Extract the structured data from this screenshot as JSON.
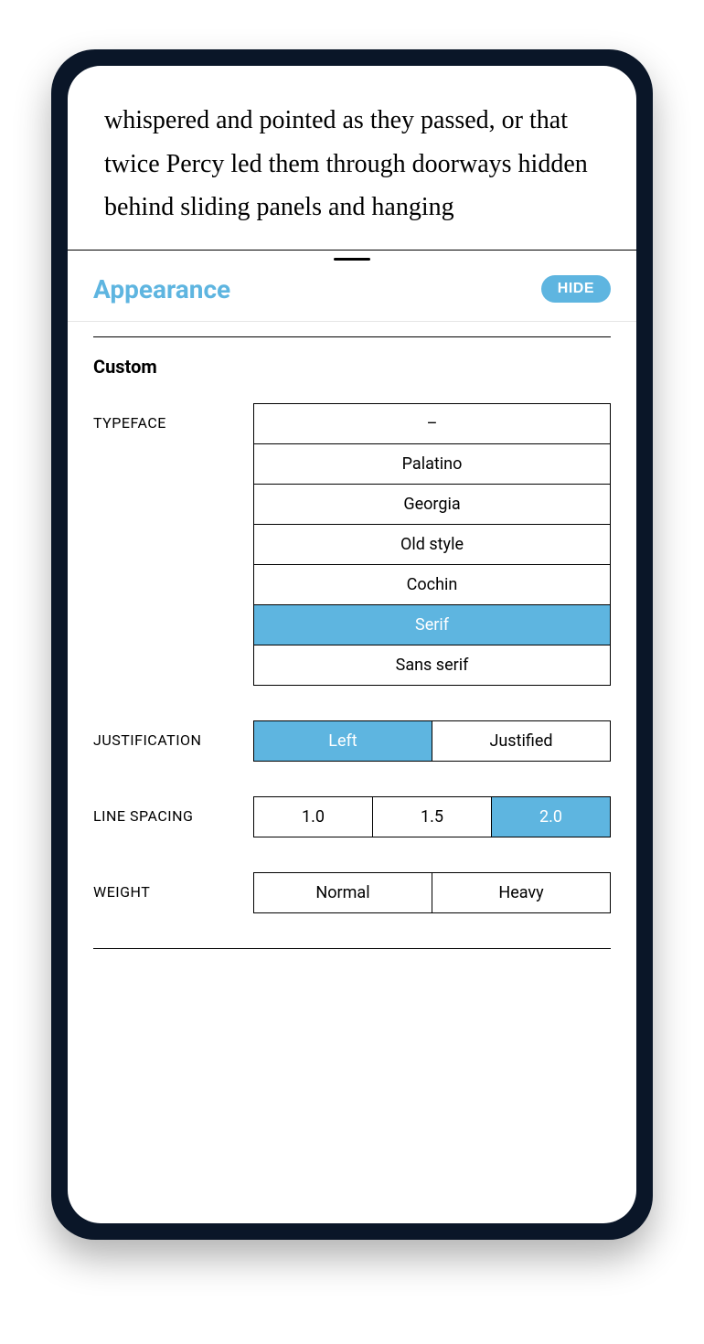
{
  "reader": {
    "text": "whispered and pointed as they passed, or that twice Percy led them through doorways hidden behind sliding panels and hanging"
  },
  "panel": {
    "title": "Appearance",
    "hide_label": "HIDE",
    "section_title": "Custom",
    "typeface": {
      "label": "TYPEFACE",
      "options": [
        "–",
        "Palatino",
        "Georgia",
        "Old style",
        "Cochin",
        "Serif",
        "Sans serif"
      ],
      "selected_index": 5
    },
    "justification": {
      "label": "JUSTIFICATION",
      "options": [
        "Left",
        "Justified"
      ],
      "selected_index": 0
    },
    "line_spacing": {
      "label": "LINE SPACING",
      "options": [
        "1.0",
        "1.5",
        "2.0"
      ],
      "selected_index": 2
    },
    "weight": {
      "label": "WEIGHT",
      "options": [
        "Normal",
        "Heavy"
      ],
      "selected_index": -1
    }
  }
}
